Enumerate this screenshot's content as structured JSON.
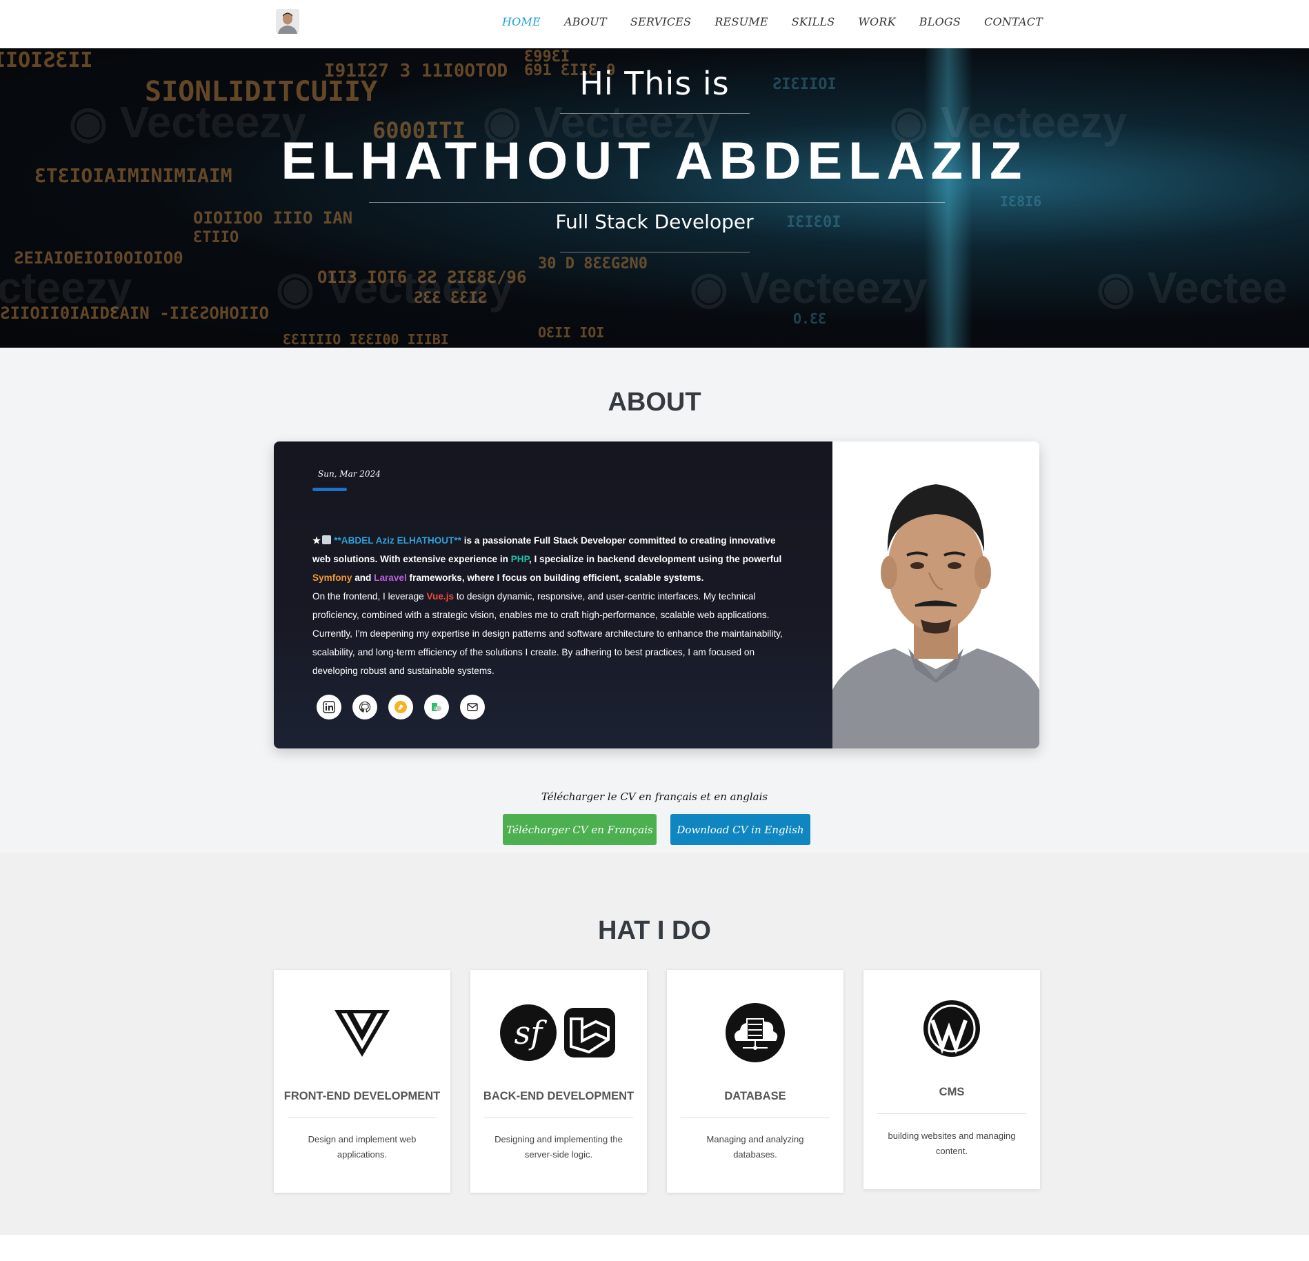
{
  "nav": {
    "items": [
      "HOME",
      "ABOUT",
      "SERVICES",
      "RESUME",
      "SKILLS",
      "WORK",
      "BLOGS",
      "CONTACT"
    ],
    "active_index": 0
  },
  "hero": {
    "greeting": "Hi This is",
    "name": "ELHATHOUT ABDELAZIZ",
    "role": "Full Stack Developer"
  },
  "about": {
    "title": "ABOUT",
    "date": "Sun, Mar 2024",
    "intro_name": "**ABDEL Aziz ELHATHOUT**",
    "intro_p1": " is a passionate Full Stack Developer committed to creating innovative web solutions. With extensive experience in ",
    "php": "PHP",
    "intro_p2": ", I specialize in backend development using the powerful ",
    "symfony": "Symfony",
    "and": " and ",
    "laravel": "Laravel",
    "intro_p3": " frameworks, where I focus on building efficient, scalable systems.",
    "frontend_p1": "On the frontend, I leverage ",
    "vue": "Vue.js",
    "frontend_p2": " to design dynamic, responsive, and user-centric interfaces. My technical proficiency, combined with a strategic vision, enables me to craft high-performance, scalable web applications. Currently, I’m deepening my expertise in design patterns and software architecture to enhance the maintainability, scalability, and long-term efficiency of the solutions I create. By adhering to best practices, I am focused on developing robust and sustainable systems.",
    "socials": [
      "linkedin-icon",
      "github-icon",
      "codepen-icon",
      "upwork-icon",
      "email-icon"
    ]
  },
  "download": {
    "caption": "Télécharger le CV en français et en anglais",
    "fr_label": "Télécharger CV en Français",
    "en_label": "Download CV in English"
  },
  "services": {
    "title": "HAT I DO",
    "items": [
      {
        "title": "FRONT-END DEVELOPMENT",
        "desc": "Design and implement web applications.",
        "icon": "vue-icon"
      },
      {
        "title": "BACK-END DEVELOPMENT",
        "desc": "Designing and implementing the server-side logic.",
        "icon": "symfony-laravel-icon"
      },
      {
        "title": "DATABASE",
        "desc": "Managing and analyzing databases.",
        "icon": "database-icon"
      },
      {
        "title": "CMS",
        "desc": "building websites and managing content.",
        "icon": "wordpress-icon"
      }
    ]
  },
  "colors": {
    "nav_active": "#1aa0d8",
    "btn_fr": "#4caf50",
    "btn_en": "#0f86c0",
    "accent_bar": "#1a73c8"
  }
}
